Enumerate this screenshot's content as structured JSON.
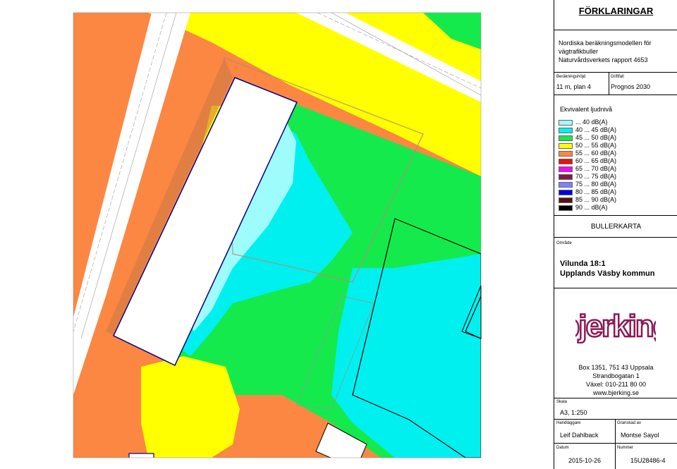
{
  "legend": {
    "title": "FÖRKLARINGAR",
    "model_lines": [
      "Nordiska beräkningsmodellen för",
      "vägtrafikbuller",
      "Naturvårdsverkets rapport 4653"
    ],
    "height_label": "Beräkningshöjd",
    "height_value": "11 m, plan 4",
    "case_label": "Driftfall",
    "case_value": "Prognos 2030",
    "level_title": "Ekvivalent ljudnivå",
    "levels": [
      {
        "label": "... 40 dB(A)",
        "color": "#9ffcfc"
      },
      {
        "label": "40 ... 45 dB(A)",
        "color": "#00f0f0"
      },
      {
        "label": "45 ... 50 dB(A)",
        "color": "#15ea4d"
      },
      {
        "label": "50 ... 55 dB(A)",
        "color": "#ffff00"
      },
      {
        "label": "55 ... 60 dB(A)",
        "color": "#fb8743"
      },
      {
        "label": "60 ... 65 dB(A)",
        "color": "#ee1010"
      },
      {
        "label": "65 ... 70 dB(A)",
        "color": "#ff00ff"
      },
      {
        "label": "70 ... 75 dB(A)",
        "color": "#80184a"
      },
      {
        "label": "75 ... 80 dB(A)",
        "color": "#8080ff"
      },
      {
        "label": "80 ... 85 dB(A)",
        "color": "#0000e0"
      },
      {
        "label": "85 ... 90 dB(A)",
        "color": "#551010"
      },
      {
        "label": "90 ... dB(A)",
        "color": "#000000"
      }
    ],
    "map_type": "BULLERKARTA",
    "area_label": "Område",
    "area_lines": [
      "Vilunda 18:1",
      "Upplands Väsby kommun"
    ],
    "logo_text": "bjerking",
    "logo_color": "#8b1a55",
    "address_lines": [
      "Box 1351, 751 43 Uppsala",
      "Strandbogatan 1",
      "Växel: 010-211 80 00",
      "www.bjerking.se"
    ],
    "scale_label": "Skala",
    "scale_value": "A3, 1:250",
    "handler_label": "Handläggare",
    "handler_value": "Leif Dahlback",
    "reviewed_label": "Granskad av",
    "reviewed_value": "Montse Sayol",
    "date_label": "Datum",
    "date_value": "2015-10-26",
    "number_label": "Nummer",
    "number_value": "15U28486-4"
  }
}
